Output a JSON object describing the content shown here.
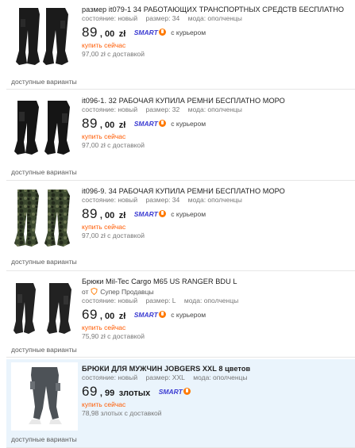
{
  "listings": [
    {
      "title": "размер it079-1 34 РАБОТАЮЩИХ ТРАНСПОРТНЫХ СРЕДСТВ БЕСПЛАТНО",
      "seller": "",
      "attrs": [
        "состояние: новый",
        "размер: 34",
        "мода: ополченцы"
      ],
      "price_int": "89",
      "price_dec": ", 00",
      "currency": "zł",
      "smart": "SMART",
      "courier": "с курьером",
      "buy_now": "купить сейчас",
      "delivery": "97,00 zł с доставкой",
      "variants": "доступные варианты",
      "icon": "pants-black-icon"
    },
    {
      "title": "it096-1. 32 РАБОЧАЯ КУПИЛА РЕМНИ БЕСПЛАТНО МОРО",
      "seller": "",
      "attrs": [
        "состояние: новый",
        "размер: 32",
        "мода: ополченцы"
      ],
      "price_int": "89",
      "price_dec": ", 00",
      "currency": "zł",
      "smart": "SMART",
      "courier": "с курьером",
      "buy_now": "купить сейчас",
      "delivery": "97,00 zł с доставкой",
      "variants": "доступные варианты",
      "icon": "pants-black-icon"
    },
    {
      "title": "it096-9. 34 РАБОЧАЯ КУПИЛА РЕМНИ БЕСПЛАТНО МОРО",
      "seller": "",
      "attrs": [
        "состояние: новый",
        "размер: 34",
        "мода: ополченцы"
      ],
      "price_int": "89",
      "price_dec": ", 00",
      "currency": "zł",
      "smart": "SMART",
      "courier": "с курьером",
      "buy_now": "купить сейчас",
      "delivery": "97,00 zł с доставкой",
      "variants": "доступные варианты",
      "icon": "pants-camo-icon"
    },
    {
      "title": "Брюки Mil-Tec Cargo M65 US RANGER BDU L",
      "seller": "Супер Продавцы",
      "seller_prefix": "от",
      "attrs": [
        "состояние: новый",
        "размер: L",
        "мода: ополченцы"
      ],
      "price_int": "69",
      "price_dec": ", 00",
      "currency": "zł",
      "smart": "SMART",
      "courier": "с курьером",
      "buy_now": "купить сейчас",
      "delivery": "75,90 zł с доставкой",
      "variants": "доступные варианты",
      "icon": "pants-black-icon"
    },
    {
      "title": "БРЮКИ ДЛЯ МУЖЧИН JOBGERS XXL 8 цветов",
      "seller": "",
      "attrs": [
        "состояние: новый",
        "размер: XXL",
        "мода: ополченцы"
      ],
      "price_int": "69",
      "price_dec": ", 99",
      "currency": "злотых",
      "smart": "SMART",
      "courier": "",
      "buy_now": "купить сейчас",
      "delivery": "78,98 злотых с доставкой",
      "variants": "доступные варианты",
      "icon": "pants-grey-jogger-icon"
    }
  ],
  "colors": {
    "highlight_bg": "#eaf4fc",
    "buy_now": "#ff5a00",
    "smart": "#3b3bd1",
    "smart_badge": "#ff7a00"
  }
}
